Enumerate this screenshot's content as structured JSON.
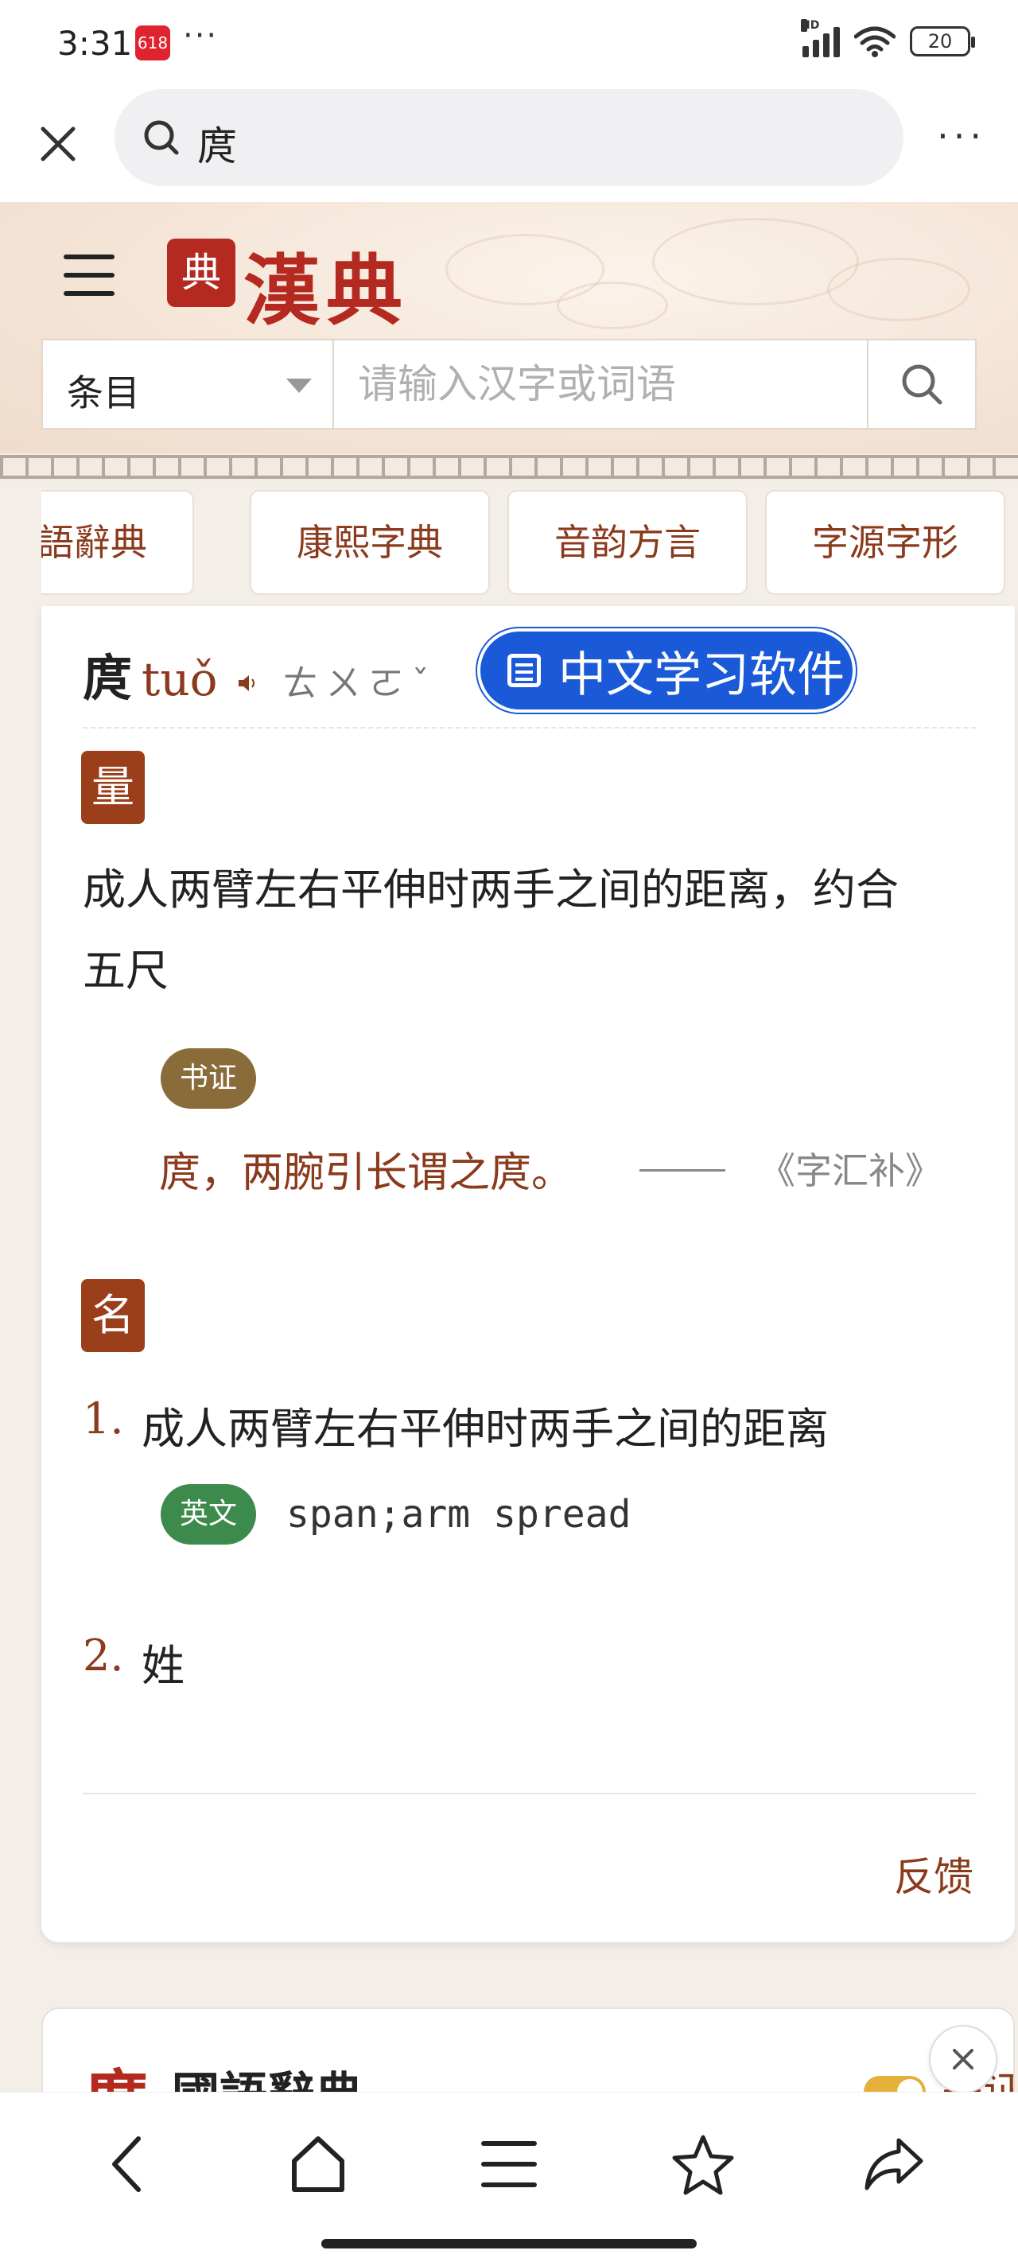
{
  "status_bar": {
    "time": "3:31",
    "logo_text": "618",
    "more": "···",
    "network": "HD",
    "battery": "20"
  },
  "browser": {
    "query": "庹",
    "more": "···"
  },
  "site": {
    "seal": "典",
    "logo": "漢典",
    "category": "条目",
    "search_placeholder": "请输入汉字或词语"
  },
  "tabs": [
    "國語辭典",
    "康熙字典",
    "音韵方言",
    "字源字形"
  ],
  "entry": {
    "char": "庹",
    "pinyin": "tuǒ",
    "zhuyin": "ㄊㄨㄛˇ",
    "promo": "中文学习软件",
    "sections": [
      {
        "pos": "量",
        "definition_line1": "成人两臂左右平伸时两手之间的距离，约合",
        "definition_line2": "五尺",
        "evidence_tag": "书证",
        "quote": "庹，两腕引长谓之庹。",
        "quote_dash": "——",
        "quote_source": "《字汇补》"
      },
      {
        "pos": "名",
        "items": [
          {
            "num": "1.",
            "text": "成人两臂左右平伸时两手之间的距离",
            "english_tag": "英文",
            "english": "span;arm spread"
          },
          {
            "num": "2.",
            "text": "姓"
          }
        ]
      }
    ],
    "feedback": "反馈"
  },
  "next_card": {
    "char": "庹",
    "title": "國語辭典",
    "more": "书证"
  },
  "colors": {
    "accent": "#8b3a1c",
    "seal_red": "#b52a20",
    "promo_blue": "#1a5ad8"
  },
  "bottom_nav": [
    "back-icon",
    "home-icon",
    "menu-icon",
    "star-icon",
    "share-icon"
  ]
}
